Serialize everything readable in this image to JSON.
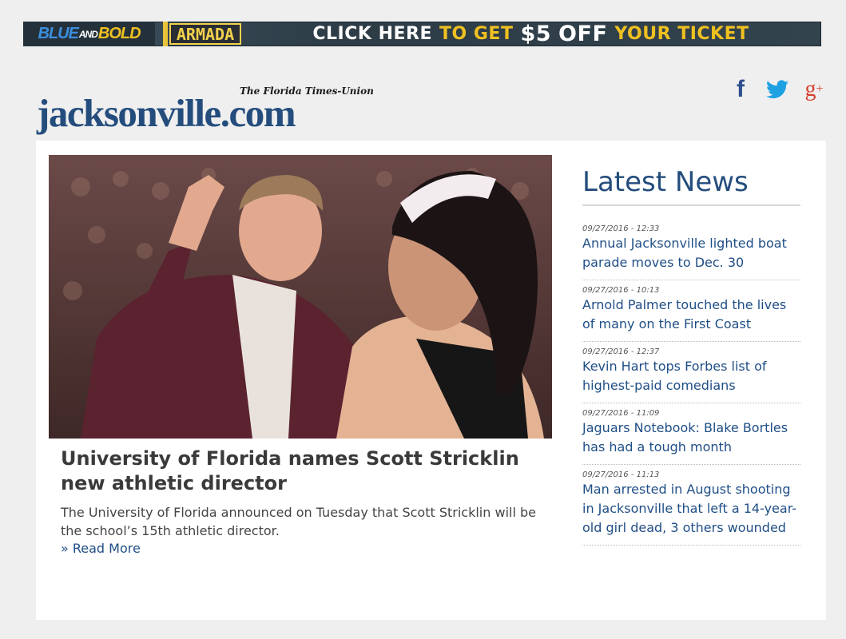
{
  "ad": {
    "blue": "BLUE",
    "and": "AND",
    "bold": "BOLD",
    "armada": "ARMADA",
    "cta_part1": "CLICK HERE",
    "cta_part2": "TO GET",
    "cta_amount": "$5",
    "cta_part3": "OFF",
    "cta_part4": "YOUR TICKET"
  },
  "header": {
    "paper_name": "The Florida Times-Union",
    "site_name": "jacksonville.com"
  },
  "social": {
    "facebook": "f",
    "googleplus": "g",
    "googleplus_sup": "+"
  },
  "featured": {
    "headline": "University of Florida names Scott Stricklin new athletic director",
    "summary": "The University of Florida announced on Tuesday that Scott Stricklin will be the school’s 15th athletic director.",
    "read_more": "» Read More",
    "image_icon": "photo-handshake-basketball"
  },
  "latest": {
    "heading": "Latest News",
    "items": [
      {
        "date": "09/27/2016 - 12:33",
        "title": "Annual Jacksonville lighted boat parade moves to Dec. 30"
      },
      {
        "date": "09/27/2016 - 10:13",
        "title": "Arnold Palmer touched the lives of many on the First Coast"
      },
      {
        "date": "09/27/2016 - 12:37",
        "title": "Kevin Hart tops Forbes list of highest-paid comedians"
      },
      {
        "date": "09/27/2016 - 11:09",
        "title": "Jaguars Notebook: Blake Bortles has had a tough month"
      },
      {
        "date": "09/27/2016 - 11:13",
        "title": "Man arrested in August shooting in Jacksonville that left a 14-year-old girl dead, 3 others wounded"
      }
    ]
  },
  "colors": {
    "brand_blue": "#244d7d",
    "link_blue": "#1f4e86",
    "ad_yellow": "#f0c020"
  }
}
